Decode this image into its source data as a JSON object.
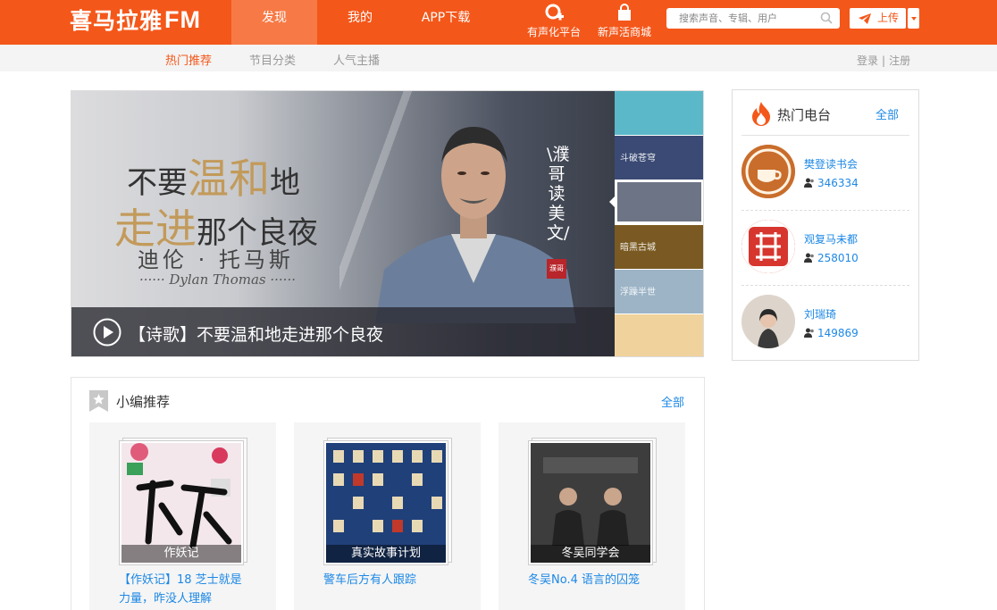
{
  "header": {
    "logo_text": "喜马拉雅",
    "logo_suffix": "FM",
    "nav": [
      {
        "label": "发现",
        "active": true
      },
      {
        "label": "我的",
        "active": false
      },
      {
        "label": "APP下载",
        "active": false
      }
    ],
    "ext_links": [
      {
        "label": "有声化平台",
        "icon": "bulb-plus-icon"
      },
      {
        "label": "新声活商城",
        "icon": "shopping-bag-icon"
      }
    ],
    "search_placeholder": "搜索声音、专辑、用户",
    "upload_label": "上传"
  },
  "subnav": {
    "items": [
      {
        "label": "热门推荐",
        "active": true
      },
      {
        "label": "节目分类",
        "active": false
      },
      {
        "label": "人气主播",
        "active": false
      }
    ],
    "login": "登录",
    "separator": "|",
    "register": "注册"
  },
  "banner": {
    "title_pre1": "不要",
    "title_big1": "温和",
    "title_post1": "地",
    "title_big2": "走进",
    "title_post2": "那个良夜",
    "author": "迪伦 · 托马斯",
    "author_en": "······ Dylan Thomas ······",
    "vertical_text": "\\濮哥读美文/",
    "seal": "濮哥",
    "caption": "【诗歌】不要温和地走进那个良夜",
    "thumbs": [
      {
        "text": "",
        "color": "#5bb8c9"
      },
      {
        "text": "斗破苍穹",
        "color": "#3a4a74"
      },
      {
        "text": "",
        "color": "#6d7485"
      },
      {
        "text": "暗黑古城",
        "color": "#7a5a22"
      },
      {
        "text": "浮躁半世",
        "color": "#9cb4c6"
      },
      {
        "text": "",
        "color": "#f0d29c"
      }
    ]
  },
  "recommend": {
    "title": "小编推荐",
    "more": "全部",
    "items": [
      {
        "cover_label": "作妖记",
        "title": "【作妖记】18 芝士就是力量，昨没人理解",
        "cover_color": "#f3e7ec"
      },
      {
        "cover_label": "真实故事计划",
        "title": "警车后方有人跟踪",
        "cover_color": "#1f3f78"
      },
      {
        "cover_label": "冬吴同学会",
        "title": "冬吴No.4 语言的囚笼",
        "cover_color": "#3b3b3b"
      }
    ]
  },
  "hot_radio": {
    "title": "热门电台",
    "more": "全部",
    "items": [
      {
        "name": "樊登读书会",
        "count": "346334",
        "avatar_color": "#c96d2c"
      },
      {
        "name": "观复马未都",
        "count": "258010",
        "avatar_color": "#d6362e"
      },
      {
        "name": "刘瑞琦",
        "count": "149869",
        "avatar_color": "#d8d1c8"
      }
    ]
  },
  "colors": {
    "brand": "#f4571a",
    "link": "#1d88e5"
  }
}
